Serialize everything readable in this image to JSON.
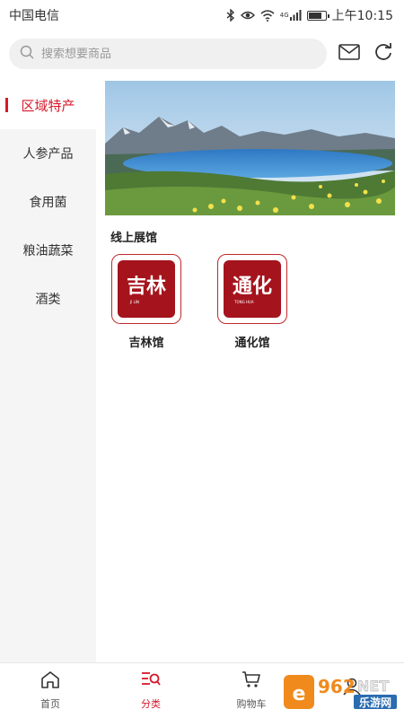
{
  "status_bar": {
    "carrier": "中国电信",
    "network": "4G",
    "time": "上午10:15"
  },
  "search": {
    "placeholder": "搜索想要商品"
  },
  "sidebar": {
    "items": [
      {
        "label": "区域特产",
        "active": true
      },
      {
        "label": "人参产品",
        "active": false
      },
      {
        "label": "食用菌",
        "active": false
      },
      {
        "label": "粮油蔬菜",
        "active": false
      },
      {
        "label": "酒类",
        "active": false
      }
    ]
  },
  "main": {
    "section_title": "线上展馆",
    "pavilions": [
      {
        "name": "吉林馆",
        "logo_text": "吉林",
        "logo_subtext": "JI LIN"
      },
      {
        "name": "通化馆",
        "logo_text": "通化",
        "logo_subtext": "TONG HUA"
      }
    ]
  },
  "bottom_nav": {
    "items": [
      {
        "label": "首页",
        "icon": "home-icon",
        "active": false
      },
      {
        "label": "分类",
        "icon": "category-icon",
        "active": true
      },
      {
        "label": "购物车",
        "icon": "cart-icon",
        "active": false
      },
      {
        "label": "",
        "icon": "user-icon",
        "active": false
      }
    ]
  },
  "watermark": {
    "text_top": "962",
    "text_right": "NET",
    "text_bottom": "乐游网"
  },
  "colors": {
    "accent": "#d51a2c",
    "logo_red": "#a5141d",
    "sidebar_bg": "#f5f5f5"
  }
}
